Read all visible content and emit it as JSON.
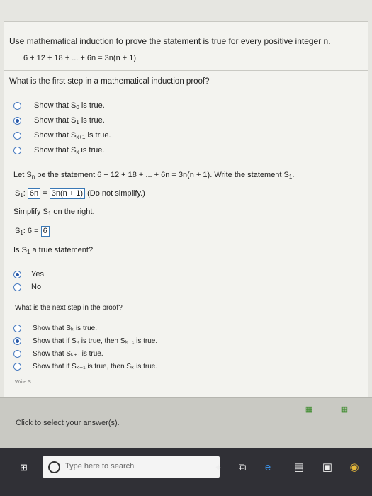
{
  "question1": {
    "prompt": "Use mathematical induction to prove the statement is true for every positive integer n.",
    "equation": "6 + 12 + 18 + ... + 6n = 3n(n + 1)"
  },
  "question2": {
    "prompt": "What is the first step in a mathematical induction proof?",
    "options": [
      {
        "pre": "Show that S",
        "sub": "0",
        "post": " is true.",
        "selected": false
      },
      {
        "pre": "Show that S",
        "sub": "1",
        "post": " is true.",
        "selected": true
      },
      {
        "pre": "Show that S",
        "sub": "k+1",
        "post": " is true.",
        "selected": false
      },
      {
        "pre": "Show that S",
        "sub": "k",
        "post": " is true.",
        "selected": false
      }
    ]
  },
  "question3": {
    "prompt_pre": "Let S",
    "prompt_sub": "n",
    "prompt_mid": " be the statement 6 + 12 + 18 + ... + 6n = 3n(n + 1). Write the statement S",
    "prompt_sub2": "1",
    "prompt_post": ".",
    "answer_label": "S",
    "answer_sub": "1",
    "answer_left": "6n",
    "answer_eq": "=",
    "answer_right": "3n(n + 1)",
    "note": "(Do not simplify.)"
  },
  "question4": {
    "prompt_pre": "Simplify S",
    "prompt_sub": "1",
    "prompt_post": " on the right.",
    "answer_label": "S",
    "answer_sub": "1",
    "answer_mid": ": 6 =",
    "answer_value": "6"
  },
  "question5": {
    "prompt_pre": "Is S",
    "prompt_sub": "1",
    "prompt_post": " a true statement?",
    "options": [
      {
        "label": "Yes",
        "selected": true
      },
      {
        "label": "No",
        "selected": false
      }
    ]
  },
  "question6": {
    "prompt": "What is the next step in the proof?",
    "options": [
      {
        "text": "Show that Sₖ is true.",
        "selected": false
      },
      {
        "text": "Show that if Sₖ is true, then Sₖ₊₁ is true.",
        "selected": true
      },
      {
        "text": "Show that Sₖ₊₁ is true.",
        "selected": false
      },
      {
        "text": "Show that if Sₖ₊₁ is true, then Sₖ is true.",
        "selected": false
      }
    ]
  },
  "cutoff_text": "Write S",
  "footer": {
    "click_text": "Click to select your answer(s)."
  },
  "taskbar": {
    "search_placeholder": "Type here to search"
  }
}
